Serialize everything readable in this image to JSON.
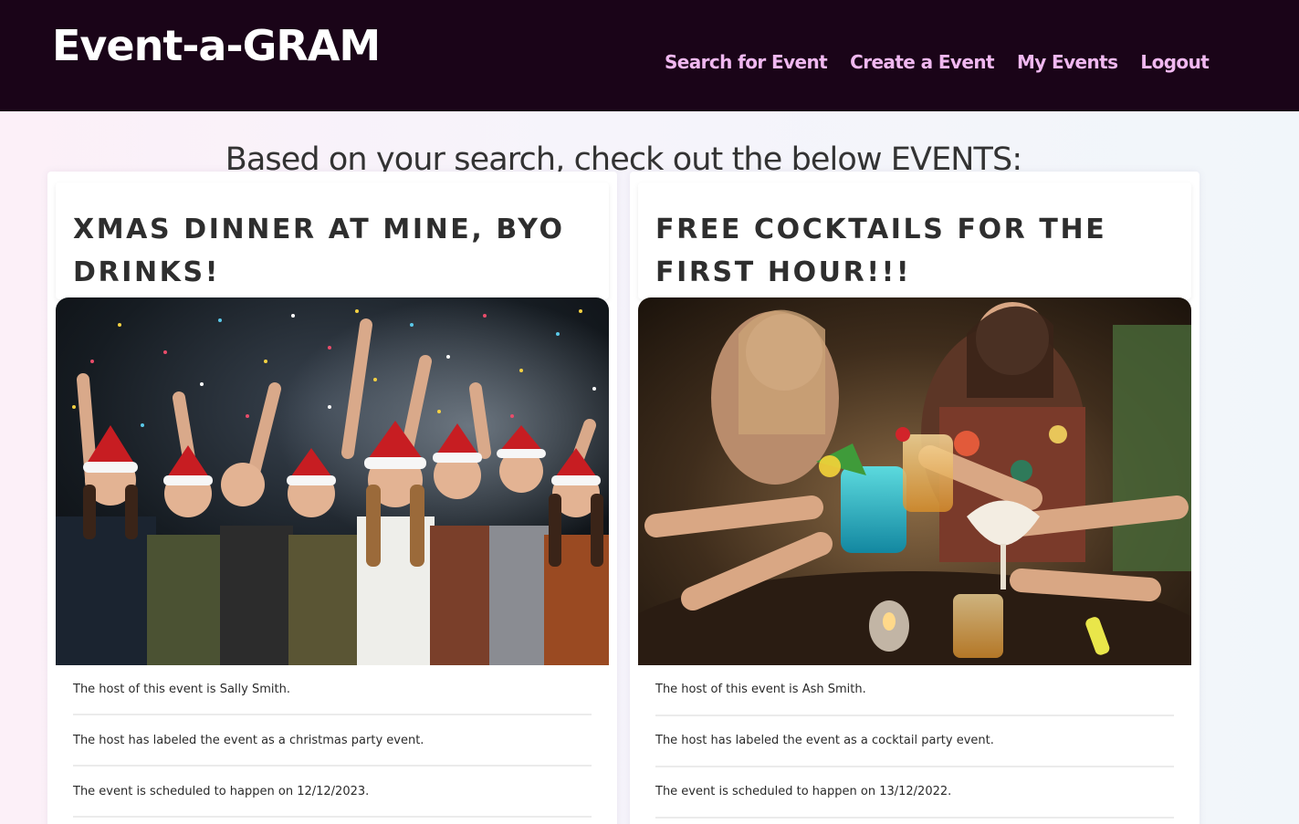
{
  "navbar": {
    "brand": "Event-a-GRAM",
    "links": [
      "Search for Event",
      "Create a Event",
      "My Events",
      "Logout"
    ]
  },
  "page": {
    "heading": "Based on your search, check out the below EVENTS:"
  },
  "events": [
    {
      "title": "XMAS DINNER AT MINE, BYO DRINKS!",
      "photo_icon": "christmas-party-photo",
      "host_text": "The host of this event is Sally Smith.",
      "label_text": "The host has labeled the event as a christmas party event.",
      "date_text": "The event is scheduled to happen on 12/12/2023."
    },
    {
      "title": "FREE COCKTAILS FOR THE FIRST HOUR!!!",
      "photo_icon": "cocktail-toast-photo",
      "host_text": "The host of this event is Ash Smith.",
      "label_text": "The host has labeled the event as a cocktail party event.",
      "date_text": "The event is scheduled to happen on 13/12/2022."
    }
  ],
  "colors": {
    "navbar_bg": "#1a0418",
    "brand": "#ffffff",
    "nav_link": "#f0b8f0",
    "heading_text": "#333333",
    "card_bg": "#ffffff"
  }
}
